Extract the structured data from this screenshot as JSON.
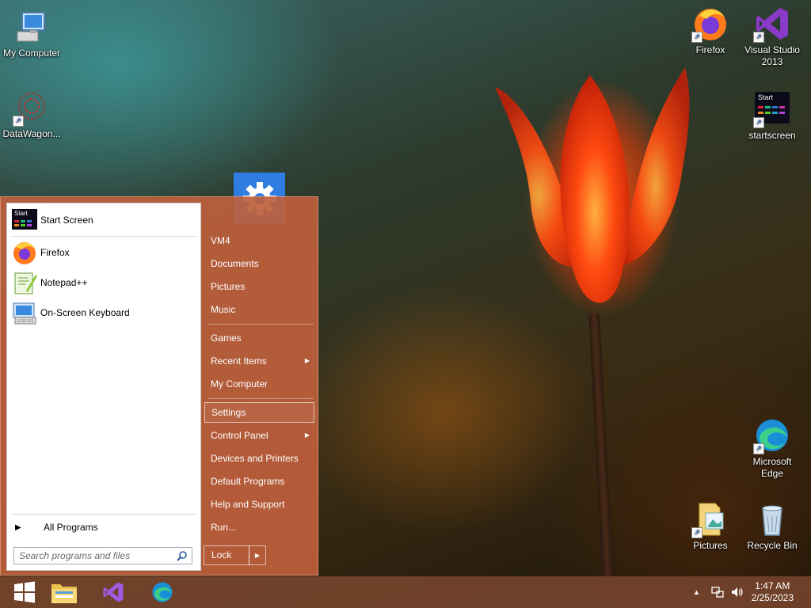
{
  "desktop": {
    "icons": {
      "my_computer": "My Computer",
      "datawagon": "DataWagon...",
      "firefox": "Firefox",
      "visual_studio": "Visual Studio 2013",
      "startscreen": "startscreen",
      "microsoft_edge": "Microsoft Edge",
      "pictures": "Pictures",
      "recycle_bin": "Recycle Bin"
    },
    "startscreen_icon_text": "Start"
  },
  "start_menu": {
    "pinned": [
      "Start Screen"
    ],
    "recent": [
      "Firefox",
      "Notepad++",
      "On-Screen Keyboard"
    ],
    "start_screen_icon_text": "Start",
    "all_programs": "All Programs",
    "search_placeholder": "Search programs and files",
    "right_items": {
      "vm4": "VM4",
      "documents": "Documents",
      "pictures": "Pictures",
      "music": "Music",
      "games": "Games",
      "recent_items": "Recent Items",
      "my_computer": "My Computer",
      "settings": "Settings",
      "control_panel": "Control Panel",
      "devices_printers": "Devices and Printers",
      "default_programs": "Default Programs",
      "help_support": "Help and Support",
      "run": "Run..."
    },
    "lock_label": "Lock"
  },
  "taskbar": {
    "time": "1:47 AM",
    "date": "2/25/2023",
    "pinned_icons": [
      "windows-logo-icon",
      "file-explorer-icon",
      "visual-studio-icon",
      "edge-icon"
    ]
  },
  "colors": {
    "start_menu_bg": "#be5f3c",
    "taskbar_bg": "#784630",
    "settings_tile": "#2f7de1"
  }
}
